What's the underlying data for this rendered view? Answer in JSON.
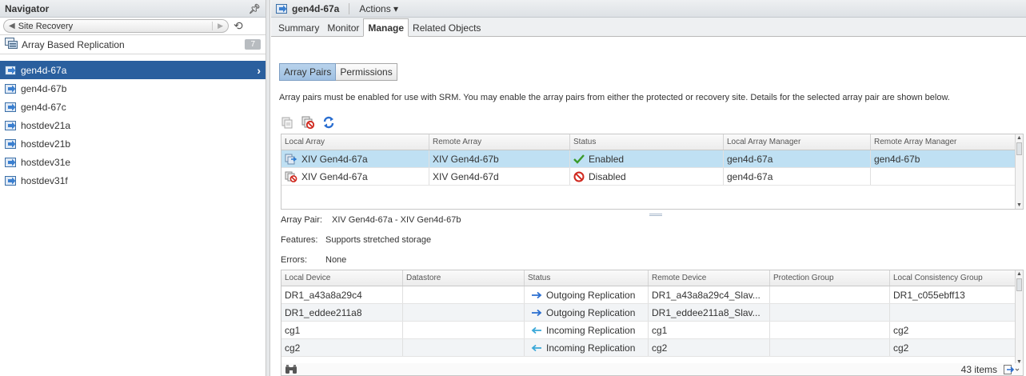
{
  "navigator": {
    "title": "Navigator",
    "back_label": "Site Recovery",
    "abr": {
      "label": "Array Based Replication",
      "count": "7"
    },
    "items": [
      {
        "label": "gen4d-67a",
        "selected": true
      },
      {
        "label": "gen4d-67b"
      },
      {
        "label": "gen4d-67c"
      },
      {
        "label": "hostdev21a"
      },
      {
        "label": "hostdev21b"
      },
      {
        "label": "hostdev31e"
      },
      {
        "label": "hostdev31f"
      }
    ]
  },
  "header": {
    "object_name": "gen4d-67a",
    "actions_label": "Actions ▾"
  },
  "tabs": [
    {
      "label": "Summary"
    },
    {
      "label": "Monitor"
    },
    {
      "label": "Manage",
      "active": true
    },
    {
      "label": "Related Objects"
    }
  ],
  "subtabs": [
    {
      "label": "Array Pairs",
      "active": true
    },
    {
      "label": "Permissions"
    }
  ],
  "description": "Array pairs must be enabled for use with SRM. You may enable the array pairs from either the protected or recovery site. Details for the selected array pair are shown below.",
  "toolbar_icons": [
    "enable-pair-icon",
    "disable-pair-icon",
    "refresh-icon"
  ],
  "array_pairs": {
    "columns": [
      "Local Array",
      "Remote Array",
      "Status",
      "Local Array Manager",
      "Remote Array Manager"
    ],
    "rows": [
      {
        "local": "XIV Gen4d-67a",
        "remote": "XIV Gen4d-67b",
        "status": "Enabled",
        "status_icon": "check-icon",
        "lam": "gen4d-67a",
        "ram": "gen4d-67b",
        "selected": true
      },
      {
        "local": "XIV Gen4d-67a",
        "remote": "XIV Gen4d-67d",
        "status": "Disabled",
        "status_icon": "no-entry-icon",
        "lam": "gen4d-67a",
        "ram": ""
      }
    ]
  },
  "details": {
    "array_pair_label": "Array Pair:",
    "array_pair_value": "XIV Gen4d-67a - XIV Gen4d-67b",
    "features_label": "Features:",
    "features_value": "Supports stretched storage",
    "errors_label": "Errors:",
    "errors_value": "None"
  },
  "devices": {
    "columns": [
      "Local Device",
      "Datastore",
      "Status",
      "Remote Device",
      "Protection Group",
      "Local Consistency Group"
    ],
    "rows": [
      {
        "local": "DR1_a43a8a29c4",
        "datastore": "",
        "direction": "outgoing",
        "status": "Outgoing Replication",
        "remote": "DR1_a43a8a29c4_Slav...",
        "pg": "",
        "lcg": "DR1_c055ebff13"
      },
      {
        "local": "DR1_eddee211a8",
        "datastore": "",
        "direction": "outgoing",
        "status": "Outgoing Replication",
        "remote": "DR1_eddee211a8_Slav...",
        "pg": "",
        "lcg": ""
      },
      {
        "local": "cg1",
        "datastore": "",
        "direction": "incoming",
        "status": "Incoming Replication",
        "remote": "cg1",
        "pg": "",
        "lcg": "cg2"
      },
      {
        "local": "cg2",
        "datastore": "",
        "direction": "incoming",
        "status": "Incoming Replication",
        "remote": "cg2",
        "pg": "",
        "lcg": "cg2"
      }
    ]
  },
  "footer": {
    "count_label": "43 items"
  },
  "colors": {
    "selection_nav": "#2a5f9e",
    "selection_row": "#bfe0f3",
    "enabled_check": "#3a9a2a",
    "disabled_red": "#d0281e",
    "arrow_blue": "#2a7ad0",
    "refresh_blue": "#2a6ed0"
  }
}
